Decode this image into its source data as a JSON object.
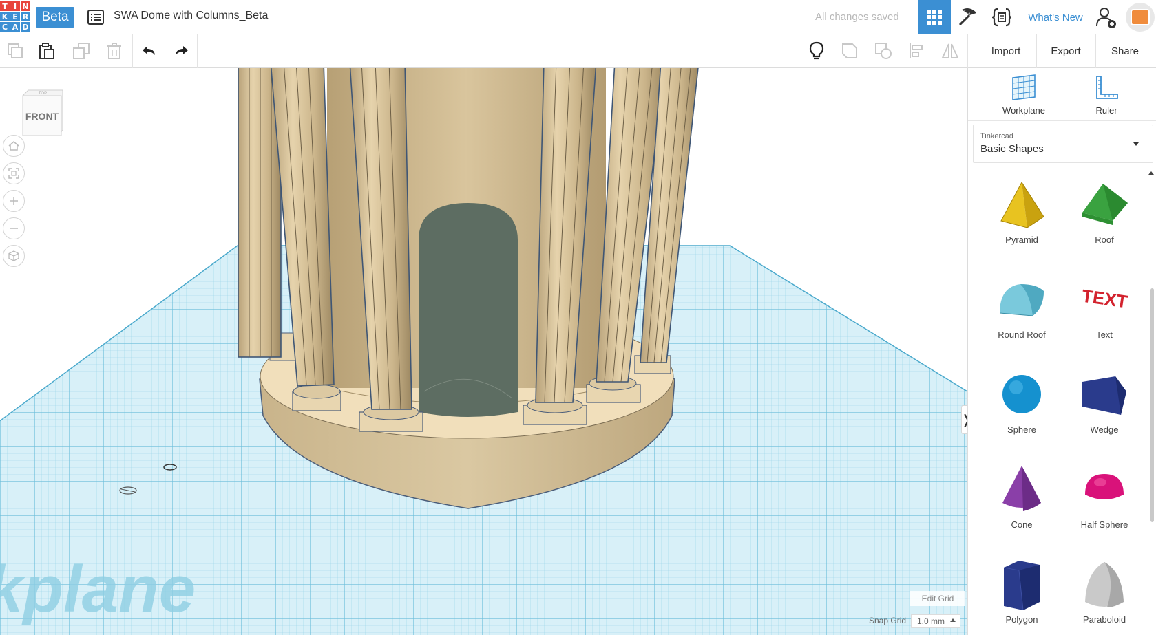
{
  "app": {
    "logo_letters": [
      "T",
      "I",
      "N",
      "K",
      "E",
      "R",
      "C",
      "A",
      "D"
    ],
    "logo_colors": [
      "#e8453c",
      "#e8453c",
      "#e8453c",
      "#3b8fd3",
      "#3b8fd3",
      "#3b8fd3",
      "#3b8fd3",
      "#3b8fd3",
      "#3b8fd3"
    ],
    "beta_label": "Beta",
    "design_title": "SWA Dome with Columns_Beta",
    "save_status": "All changes saved",
    "whats_new": "What's New",
    "accent_color": "#3b8fd3"
  },
  "toolbar": {
    "import_label": "Import",
    "export_label": "Export",
    "share_label": "Share"
  },
  "viewport": {
    "viewcube_top": "TOP",
    "viewcube_front": "FRONT",
    "workplane_watermark": "kplane",
    "edit_grid_label": "Edit Grid",
    "snap_grid_label": "Snap Grid",
    "snap_grid_value": "1.0 mm"
  },
  "panel": {
    "workplane_label": "Workplane",
    "ruler_label": "Ruler",
    "library_source": "Tinkercad",
    "library_name": "Basic Shapes",
    "shapes": [
      {
        "label": "Pyramid",
        "icon": "pyramid-icon"
      },
      {
        "label": "Roof",
        "icon": "roof-icon"
      },
      {
        "label": "Round Roof",
        "icon": "round-roof-icon"
      },
      {
        "label": "Text",
        "icon": "text-shape-icon"
      },
      {
        "label": "Sphere",
        "icon": "sphere-icon"
      },
      {
        "label": "Wedge",
        "icon": "wedge-icon"
      },
      {
        "label": "Cone",
        "icon": "cone-icon"
      },
      {
        "label": "Half Sphere",
        "icon": "half-sphere-icon"
      },
      {
        "label": "Polygon",
        "icon": "polygon-icon"
      },
      {
        "label": "Paraboloid",
        "icon": "paraboloid-icon"
      }
    ],
    "text_shape_glyphs": "TEXT"
  }
}
